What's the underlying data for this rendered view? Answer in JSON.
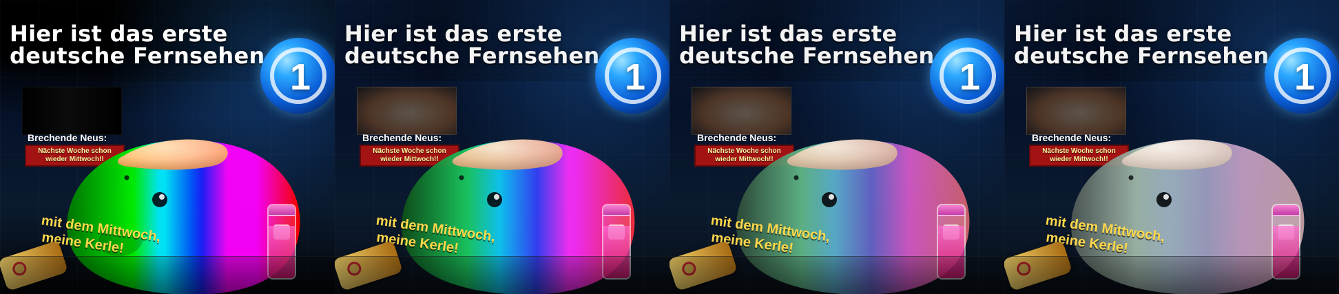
{
  "panels": [
    {
      "headline": {
        "line1": "Hier ist das erste",
        "line2": "deutsche Fernsehen"
      },
      "logo": {
        "text": "1"
      },
      "news": {
        "title": "Brechende Neus:",
        "body": "Nächste Woche schon wieder  Mittwoch!!"
      },
      "quote": {
        "line1": "mit dem Mittwoch,",
        "line2": "meine Kerle!"
      }
    },
    {
      "headline": {
        "line1": "Hier ist das erste",
        "line2": "deutsche Fernsehen"
      },
      "logo": {
        "text": "1"
      },
      "news": {
        "title": "Brechende Neus:",
        "body": "Nächste Woche schon wieder  Mittwoch!!"
      },
      "quote": {
        "line1": "mit dem Mittwoch,",
        "line2": "meine Kerle!"
      }
    },
    {
      "headline": {
        "line1": "Hier ist das erste",
        "line2": "deutsche Fernsehen"
      },
      "logo": {
        "text": "1"
      },
      "news": {
        "title": "Brechende Neus:",
        "body": "Nächste Woche schon wieder  Mittwoch!!"
      },
      "quote": {
        "line1": "mit dem Mittwoch,",
        "line2": "meine Kerle!"
      }
    },
    {
      "headline": {
        "line1": "Hier ist das erste",
        "line2": "deutsche Fernsehen"
      },
      "logo": {
        "text": "1"
      },
      "news": {
        "title": "Brechende Neus:",
        "body": "Nächste Woche schon wieder  Mittwoch!!"
      },
      "quote": {
        "line1": "mit dem Mittwoch,",
        "line2": "meine Kerle!"
      }
    }
  ]
}
